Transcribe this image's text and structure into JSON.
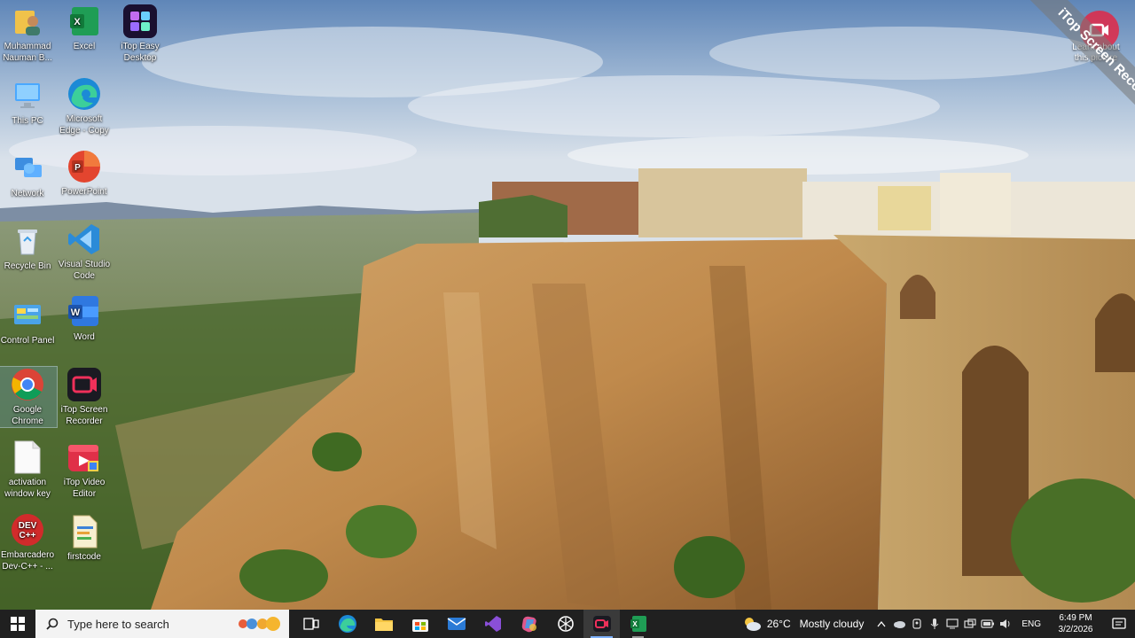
{
  "desktop": {
    "icons": [
      {
        "label": "Muhammad Nauman B...",
        "icon": "user-folder-icon"
      },
      {
        "label": "Excel",
        "icon": "excel-icon"
      },
      {
        "label": "iTop Easy Desktop",
        "icon": "itop-easy-desktop-icon"
      },
      {
        "label": "This PC",
        "icon": "this-pc-icon"
      },
      {
        "label": "Microsoft Edge - Copy",
        "icon": "edge-icon"
      },
      {
        "label": "Network",
        "icon": "network-icon"
      },
      {
        "label": "PowerPoint",
        "icon": "powerpoint-icon"
      },
      {
        "label": "Recycle Bin",
        "icon": "recycle-bin-icon"
      },
      {
        "label": "Visual Studio Code",
        "icon": "vscode-icon"
      },
      {
        "label": "Control Panel",
        "icon": "control-panel-icon"
      },
      {
        "label": "Word",
        "icon": "word-icon"
      },
      {
        "label": "Google Chrome",
        "icon": "chrome-icon"
      },
      {
        "label": "iTop Screen Recorder",
        "icon": "itop-screen-recorder-icon"
      },
      {
        "label": "activation window key",
        "icon": "text-file-icon"
      },
      {
        "label": "iTop Video Editor",
        "icon": "itop-video-editor-icon"
      },
      {
        "label": "Embarcadero Dev-C++ - ...",
        "icon": "devcpp-icon"
      },
      {
        "label": "firstcode",
        "icon": "firstcode-file-icon"
      }
    ]
  },
  "watermark": {
    "text": "iTop Screen Recorder",
    "learn_about": "Learn about this picture"
  },
  "taskbar": {
    "search_placeholder": "Type here to search",
    "weather_temp": "26°C",
    "weather_desc": "Mostly cloudy",
    "language": "ENG",
    "time": "6:49 PM",
    "date": "3/2/2026",
    "apps": [
      "task-view",
      "edge",
      "file-explorer",
      "microsoft-store",
      "mail",
      "visual-studio",
      "copilot",
      "chatgpt",
      "itop-screen-recorder",
      "excel"
    ]
  },
  "colors": {
    "taskbar": "#202020",
    "search_box": "#f3f3f3",
    "accent_active": "#7fb2ff"
  }
}
